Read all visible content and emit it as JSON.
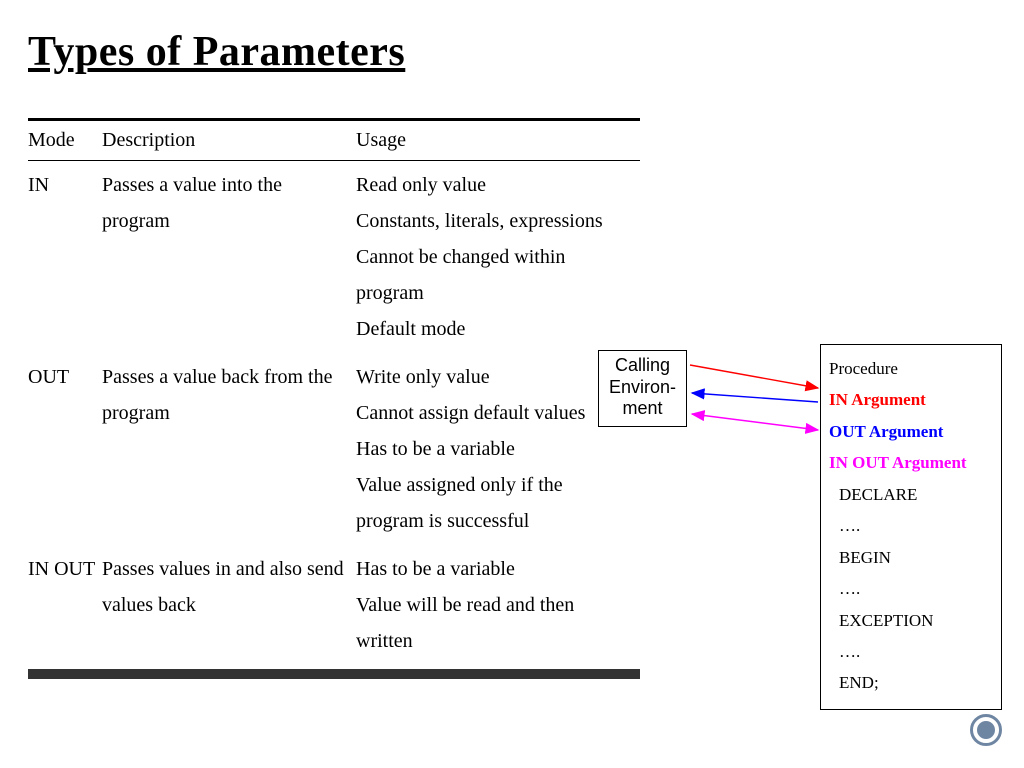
{
  "title": "Types of Parameters",
  "table": {
    "headers": {
      "mode": "Mode",
      "description": "Description",
      "usage": "Usage"
    },
    "rows": [
      {
        "mode": "IN",
        "description": "Passes a value into the program",
        "usage": "Read only value\nConstants, literals, expressions\nCannot be changed within program\nDefault mode"
      },
      {
        "mode": "OUT",
        "description": "Passes a value back from the program",
        "usage": "Write only value\nCannot assign default values\nHas to be a variable\nValue assigned only if the program is successful"
      },
      {
        "mode": "IN OUT",
        "description": "Passes values in and also send values back",
        "usage": "Has to be a variable\nValue will be read and then written"
      }
    ]
  },
  "calling_box": {
    "line1": "Calling",
    "line2": "Environ-",
    "line3": "ment"
  },
  "proc_box": {
    "title": "Procedure",
    "in_arg": "IN Argument",
    "out_arg": "OUT Argument",
    "inout_arg": "IN OUT Argument",
    "declare": "DECLARE",
    "dots1": "….",
    "begin": "BEGIN",
    "dots2": "….",
    "exception": "EXCEPTION",
    "dots3": "….",
    "end": "END;"
  },
  "arrows": {
    "in_color": "#ff0000",
    "out_color": "#0000ff",
    "inout_color": "#ff00ff"
  }
}
